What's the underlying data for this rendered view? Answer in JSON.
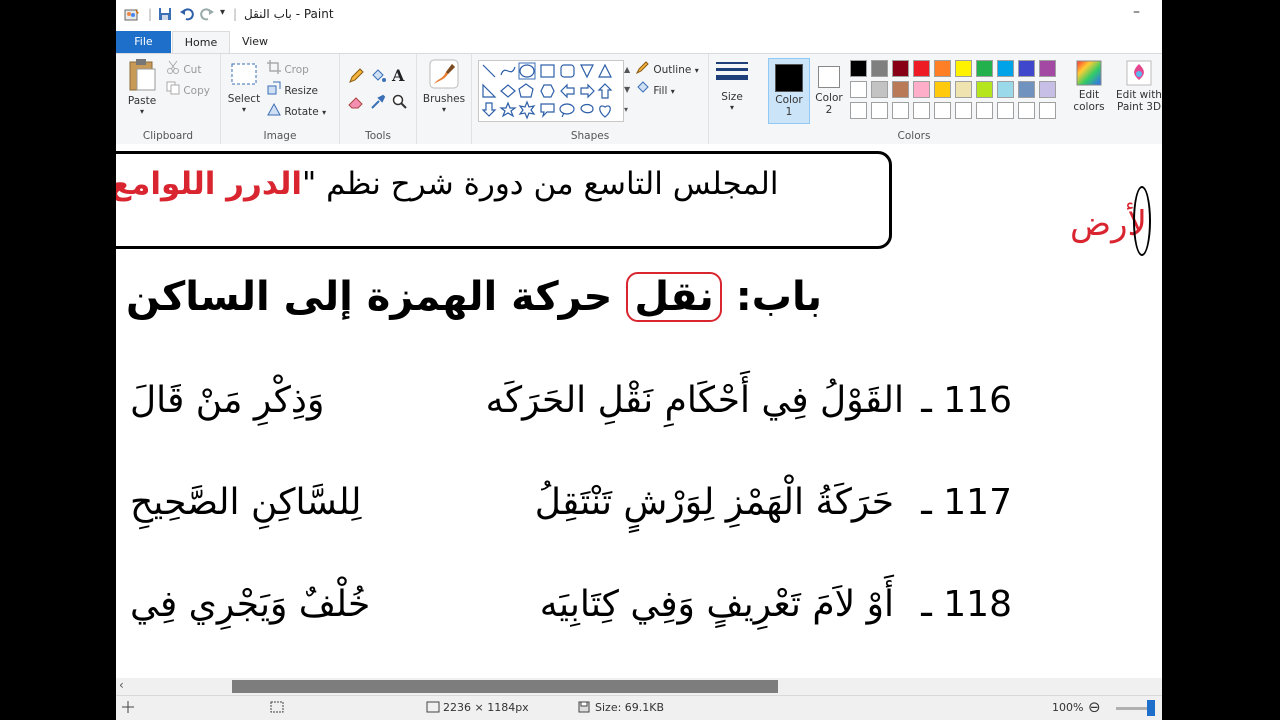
{
  "window": {
    "title": "باب النقل - Paint",
    "minimize_glyph": "–"
  },
  "tabs": {
    "file": "File",
    "home": "Home",
    "view": "View"
  },
  "clipboard": {
    "label": "Clipboard",
    "paste": "Paste",
    "cut": "Cut",
    "copy": "Copy"
  },
  "image": {
    "label": "Image",
    "select": "Select",
    "crop": "Crop",
    "resize": "Resize",
    "rotate": "Rotate"
  },
  "tools": {
    "label": "Tools"
  },
  "brushes": {
    "label": "Brushes"
  },
  "shapes": {
    "label": "Shapes",
    "outline": "Outline",
    "fill": "Fill"
  },
  "size": {
    "label": "Size"
  },
  "colors": {
    "label": "Colors",
    "color1_label": "Color",
    "color1_num": "1",
    "color2_label": "Color",
    "color2_num": "2",
    "edit_colors_1": "Edit",
    "edit_colors_2": "colors",
    "paint3d_1": "Edit with",
    "paint3d_2": "Paint 3D",
    "color1": "#000000",
    "color2": "#ffffff",
    "palette_row1": [
      "#000000",
      "#7f7f7f",
      "#880015",
      "#ed1c24",
      "#ff7f27",
      "#fff200",
      "#22b14c",
      "#00a2e8",
      "#3f48cc",
      "#a349a4"
    ],
    "palette_row2": [
      "#ffffff",
      "#c3c3c3",
      "#b97a57",
      "#ffaec9",
      "#ffc90e",
      "#efe4b0",
      "#b5e61d",
      "#99d9ea",
      "#7092be",
      "#c8bfe7"
    ],
    "palette_row3": [
      "#ffffff",
      "#ffffff",
      "#ffffff",
      "#ffffff",
      "#ffffff",
      "#ffffff",
      "#ffffff",
      "#ffffff",
      "#ffffff",
      "#ffffff"
    ]
  },
  "canvas": {
    "header_black": "المجلس التاسع من دورة شرح نظم \"",
    "header_red": "الدرر اللوامع",
    "earth_word": "لأرض",
    "chapter_prefix": "باب:",
    "chapter_boxed": "نقل",
    "chapter_rest": "حركة الهمزة إلى الساكن",
    "verses": [
      {
        "num": "116 ـ",
        "first": "القَوْلُ فِي أَحْكَامِ نَقْلِ الحَرَكَه",
        "second": "وَذِكْرِ مَنْ قَالَ"
      },
      {
        "num": "117 ـ",
        "first": "حَرَكَةُ الْهَمْزِ لِوَرْشٍ تَنْتَقِلُ",
        "second": "لِلسَّاكِنِ الصَّحِيحِ"
      },
      {
        "num": "118 ـ",
        "first": "أَوْ لاَمَ تَعْرِيفٍ وَفِي كِتَابِيَه",
        "second": "خُلْفٌ وَيَجْرِي فِي"
      }
    ],
    "accent": "#d9252f"
  },
  "status": {
    "dimensions": "2236 × 1184px",
    "size": "Size: 69.1KB",
    "zoom": "100%",
    "zoom_level_pct": 100
  }
}
